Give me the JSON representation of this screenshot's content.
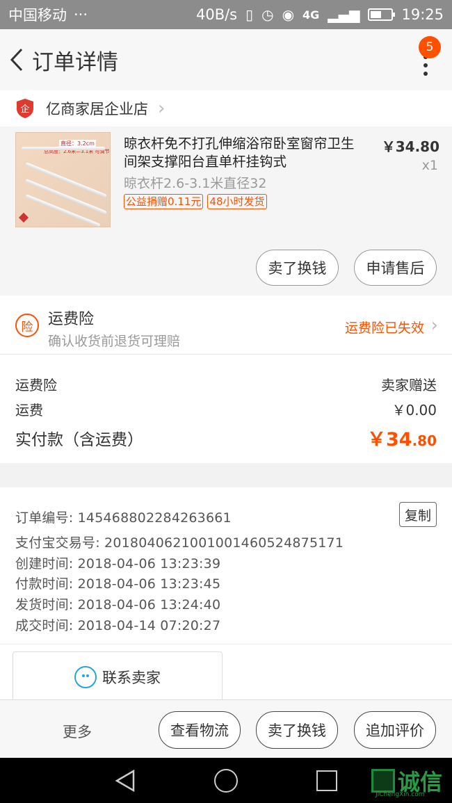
{
  "status_bar": {
    "carrier": "中国移动",
    "dots": "···",
    "speed": "40B/s",
    "network": "4G",
    "time": "19:25"
  },
  "header": {
    "title": "订单详情",
    "badge": "5"
  },
  "shop": {
    "icon_text": "企",
    "name": "亿商家居企业店"
  },
  "product": {
    "title": "晾衣杆免不打孔伸缩浴帘卧室窗帘卫生间架支撑阳台直单杆挂钩式",
    "sku": "晾衣杆2.6-3.1米直径32",
    "tags": [
      "公益捐赠0.11元",
      "48小时发货"
    ],
    "price": "￥34.80",
    "qty": "x1",
    "thumb_text1": "直径：3.2cm",
    "thumb_text2": "总高度：2.6米—3.1米 可调节",
    "actions": [
      "卖了换钱",
      "申请售后"
    ]
  },
  "insurance": {
    "icon": "险",
    "title": "运费险",
    "subtitle": "确认收货前退货可理赔",
    "status": "运费险已失效"
  },
  "fees": {
    "insurance_label": "运费险",
    "insurance_value": "卖家赠送",
    "shipping_label": "运费",
    "shipping_value": "￥0.00",
    "total_label": "实付款（含运费）",
    "total_main": "￥34",
    "total_decimal": ".80"
  },
  "order_info": {
    "order_no": "订单编号: 1454688022842636​61",
    "copy_label": "复制",
    "alipay_no": "支付宝交易号: 2018040621001001460524875171",
    "created": "创建时间: 2018-04-06 13:23:39",
    "paid": "付款时间: 2018-04-06 13:23:45",
    "shipped": "发货时间: 2018-04-06 13:24:40",
    "completed": "成交时间: 2018-04-14 07:20:27",
    "contact_label": "联系卖家"
  },
  "bottom_bar": {
    "more": "更多",
    "buttons": [
      "查看物流",
      "卖了换钱",
      "追加评价"
    ]
  },
  "watermark": {
    "text": "诚信",
    "sub": "JiChengXin.com"
  },
  "colors": {
    "accent": "#ff5000",
    "contact_icon": "#26a3e0"
  }
}
